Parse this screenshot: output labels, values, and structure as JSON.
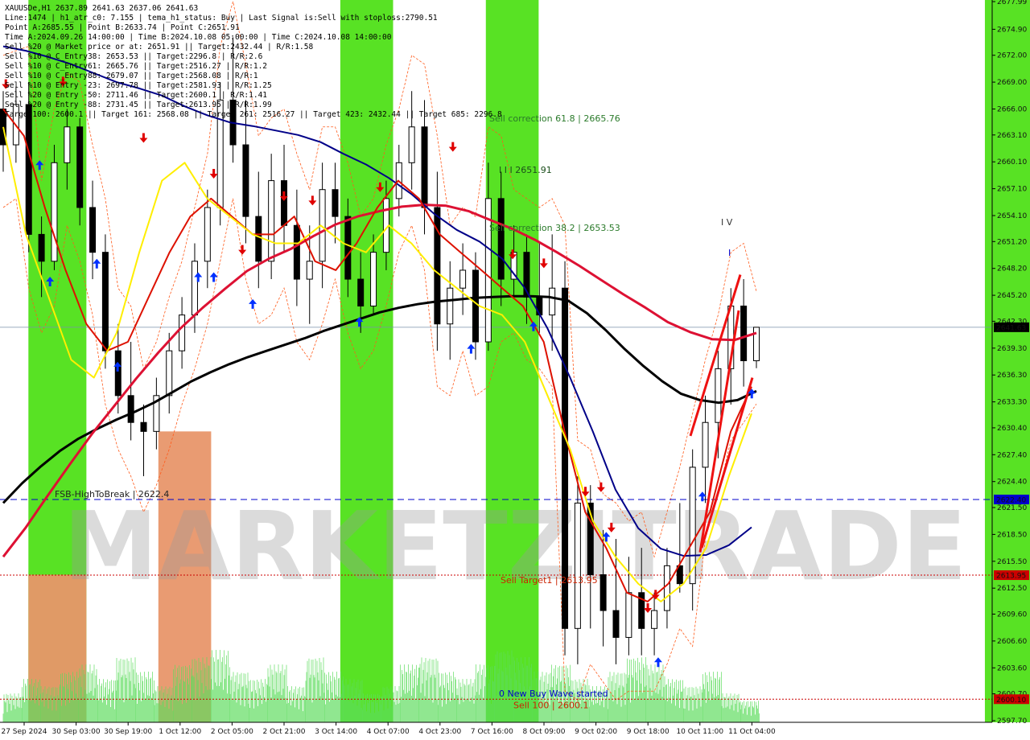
{
  "header_lines": [
    "XAUUSDe,H1  2637.89 2641.63 2637.06 2641.63",
    "Line:1474 | h1_atr_c0: 7.155 | tema_h1_status: Buy | Last Signal is:Sell with stoploss:2790.51",
    "Point A:2685.55 | Point B:2633.74 | Point C:2651.91",
    "Time A:2024.09.26 14:00:00 | Time B:2024.10.08 05:00:00 | Time C:2024.10.08 14:00:00",
    "Sell %20 @ Market price or at: 2651.91 || Target:2432.44 | R/R:1.58",
    "Sell %10 @ C_Entry38: 2653.53 || Target:2296.8 | R/R:2.6",
    "Sell %10 @ C_Entry61: 2665.76 || Target:2516.27 | R/R:1.2",
    "Sell %10 @ C_Entry88: 2679.07 || Target:2568.08 | R/R:1",
    "Sell %10 @ Entry -23: 2697.78 || Target:2581.93 | R/R:1.25",
    "Sell %20 @ Entry -50: 2711.46 || Target:2600.1 | R/R:1.41",
    "Sell %20 @ Entry -88: 2731.45 || Target:2613.95 | R/R:1.99",
    "Target100: 2600.1 || Target 161: 2568.08 || Target 261: 2516.27 || Target 423: 2432.44 || Target 685: 2296.8"
  ],
  "chart_data": {
    "type": "candlestick",
    "symbol": "XAUUSDe",
    "timeframe": "H1",
    "ylim": [
      2597.7,
      2677.99
    ],
    "y_ticks": [
      "2677.99",
      "2674.90",
      "2672.00",
      "2669.00",
      "2666.00",
      "2663.10",
      "2660.10",
      "2657.10",
      "2654.10",
      "2651.20",
      "2648.20",
      "2645.20",
      "2642.30",
      "2639.30",
      "2636.30",
      "2633.30",
      "2630.40",
      "2627.40",
      "2624.40",
      "2621.50",
      "2618.50",
      "2615.50",
      "2612.50",
      "2609.60",
      "2606.60",
      "2603.60",
      "2600.70",
      "2597.70"
    ],
    "x_ticks": [
      "27 Sep 2024",
      "30 Sep 03:00",
      "30 Sep 19:00",
      "1 Oct 12:00",
      "2 Oct 05:00",
      "2 Oct 21:00",
      "3 Oct 14:00",
      "4 Oct 07:00",
      "4 Oct 23:00",
      "7 Oct 16:00",
      "8 Oct 09:00",
      "9 Oct 02:00",
      "9 Oct 18:00",
      "10 Oct 11:00",
      "11 Oct 04:00"
    ],
    "price_tags": [
      {
        "value": 2641.63,
        "label": "2641.63",
        "color": "#000000"
      },
      {
        "value": 2622.4,
        "label": "2622.40",
        "color": "#0000cc"
      },
      {
        "value": 2613.95,
        "label": "2613.95",
        "color": "#cc0000"
      },
      {
        "value": 2600.1,
        "label": "2600.10",
        "color": "#cc0000"
      }
    ],
    "levels": [
      {
        "name": "FSB-HighToBreak",
        "value": 2622.4,
        "label": "FSB-HighToBreak | 2622.4",
        "color": "#0000cc"
      },
      {
        "name": "Sell Target1",
        "value": 2613.95,
        "label": "Sell Target1 | 2613.95",
        "color": "#cc0000"
      },
      {
        "name": "Sell 100",
        "value": 2600.1,
        "label": "Sell 100 | 2600.1",
        "color": "#cc0000"
      }
    ],
    "annotations": [
      {
        "text": "Sell correction 61.8 | 2665.76",
        "color": "#2a7a2a"
      },
      {
        "text": "Sell correction 38.2 | 2653.53",
        "color": "#2a7a2a"
      },
      {
        "text": "I I I  2651.91",
        "color": "#2a7a2a"
      },
      {
        "text": "I V",
        "color": "#333333"
      },
      {
        "text": "I",
        "color": "#0000cc"
      },
      {
        "text": "0 New Buy Wave started",
        "color": "#0000cc"
      }
    ],
    "green_bands": [
      [
        0.5,
        1.6
      ],
      [
        6.5,
        7.5
      ],
      [
        9.3,
        10.3
      ],
      [
        18.9,
        20.0
      ],
      [
        21.3,
        22.2
      ],
      [
        23.8,
        24.7
      ]
    ],
    "orange_bands": [
      [
        0.5,
        1.6,
        2614.0
      ],
      [
        3.0,
        4.0,
        2630.0
      ]
    ],
    "candles": [
      [
        2666.0,
        2668.0,
        2659.0,
        2662.0
      ],
      [
        2662.0,
        2668.5,
        2660.0,
        2666.5
      ],
      [
        2666.5,
        2669.0,
        2650.0,
        2652.0
      ],
      [
        2652.0,
        2654.0,
        2645.0,
        2649.0
      ],
      [
        2649.0,
        2662.0,
        2648.0,
        2660.0
      ],
      [
        2660.0,
        2666.0,
        2657.0,
        2664.0
      ],
      [
        2664.0,
        2665.0,
        2653.0,
        2655.0
      ],
      [
        2655.0,
        2658.0,
        2647.0,
        2650.0
      ],
      [
        2650.0,
        2652.0,
        2637.0,
        2639.0
      ],
      [
        2639.0,
        2642.0,
        2632.0,
        2634.0
      ],
      [
        2634.0,
        2640.0,
        2629.0,
        2631.0
      ],
      [
        2631.0,
        2633.0,
        2625.0,
        2630.0
      ],
      [
        2630.0,
        2636.0,
        2628.0,
        2634.0
      ],
      [
        2634.0,
        2641.0,
        2632.0,
        2639.0
      ],
      [
        2639.0,
        2645.0,
        2637.0,
        2643.0
      ],
      [
        2643.0,
        2651.0,
        2641.0,
        2649.0
      ],
      [
        2649.0,
        2657.0,
        2646.0,
        2655.0
      ],
      [
        2655.0,
        2669.0,
        2653.0,
        2667.0
      ],
      [
        2667.0,
        2674.0,
        2660.0,
        2662.0
      ],
      [
        2662.0,
        2667.0,
        2651.0,
        2654.0
      ],
      [
        2654.0,
        2659.0,
        2646.0,
        2649.0
      ],
      [
        2649.0,
        2661.0,
        2647.0,
        2658.0
      ],
      [
        2658.0,
        2662.0,
        2650.0,
        2653.0
      ],
      [
        2653.0,
        2657.0,
        2644.0,
        2647.0
      ],
      [
        2647.0,
        2653.0,
        2642.0,
        2649.0
      ],
      [
        2649.0,
        2660.0,
        2646.0,
        2657.0
      ],
      [
        2657.0,
        2660.0,
        2651.0,
        2654.0
      ],
      [
        2654.0,
        2656.0,
        2645.0,
        2647.0
      ],
      [
        2647.0,
        2650.0,
        2641.0,
        2644.0
      ],
      [
        2644.0,
        2652.0,
        2643.0,
        2650.0
      ],
      [
        2650.0,
        2658.0,
        2648.0,
        2656.0
      ],
      [
        2656.0,
        2662.0,
        2654.0,
        2660.0
      ],
      [
        2660.0,
        2668.0,
        2657.0,
        2664.0
      ],
      [
        2664.0,
        2667.0,
        2652.0,
        2655.0
      ],
      [
        2655.0,
        2659.0,
        2639.0,
        2642.0
      ],
      [
        2642.0,
        2649.0,
        2638.0,
        2646.0
      ],
      [
        2646.0,
        2651.0,
        2643.0,
        2648.0
      ],
      [
        2648.0,
        2650.0,
        2638.0,
        2640.0
      ],
      [
        2640.0,
        2660.0,
        2639.0,
        2656.0
      ],
      [
        2656.0,
        2659.0,
        2644.0,
        2647.0
      ],
      [
        2647.0,
        2653.0,
        2645.0,
        2650.0
      ],
      [
        2650.0,
        2652.0,
        2642.0,
        2645.0
      ],
      [
        2645.0,
        2651.0,
        2641.0,
        2643.0
      ],
      [
        2643.0,
        2652.0,
        2639.0,
        2646.0
      ],
      [
        2646.0,
        2649.0,
        2605.0,
        2608.0
      ],
      [
        2608.0,
        2625.0,
        2604.0,
        2622.0
      ],
      [
        2622.0,
        2624.0,
        2608.0,
        2614.0
      ],
      [
        2614.0,
        2619.0,
        2606.0,
        2610.0
      ],
      [
        2610.0,
        2618.0,
        2604.0,
        2607.0
      ],
      [
        2607.0,
        2616.0,
        2605.0,
        2612.0
      ],
      [
        2612.0,
        2617.0,
        2605.0,
        2608.0
      ],
      [
        2608.0,
        2612.0,
        2605.0,
        2610.0
      ],
      [
        2610.0,
        2617.0,
        2608.0,
        2615.0
      ],
      [
        2615.0,
        2622.0,
        2612.0,
        2613.0
      ],
      [
        2613.0,
        2628.0,
        2610.0,
        2626.0
      ],
      [
        2626.0,
        2634.0,
        2622.0,
        2631.0
      ],
      [
        2631.0,
        2639.0,
        2627.0,
        2637.0
      ],
      [
        2637.0,
        2646.0,
        2633.0,
        2644.0
      ],
      [
        2644.0,
        2647.0,
        2635.0,
        2637.89
      ],
      [
        2637.89,
        2641.63,
        2637.06,
        2641.63
      ]
    ],
    "series": [
      {
        "name": "ma_slow",
        "color": "#000000",
        "width": 3,
        "values": [
          2622,
          2624.2,
          2626.1,
          2627.8,
          2629.2,
          2630.3,
          2631.3,
          2632.2,
          2633.2,
          2634.4,
          2635.6,
          2636.6,
          2637.5,
          2638.3,
          2639.0,
          2639.7,
          2640.4,
          2641.2,
          2641.9,
          2642.6,
          2643.3,
          2643.8,
          2644.2,
          2644.5,
          2644.7,
          2644.9,
          2645.0,
          2645.1,
          2645.1,
          2645.0,
          2644.6,
          2643.2,
          2641.3,
          2639.2,
          2637.3,
          2635.6,
          2634.2,
          2633.5,
          2633.2,
          2633.5,
          2634.5
        ]
      },
      {
        "name": "ma_mid",
        "color": "#dd1133",
        "width": 3,
        "values": [
          2616,
          2619.2,
          2622.8,
          2626.3,
          2629.7,
          2632.8,
          2635.9,
          2638.8,
          2641.5,
          2643.8,
          2645.9,
          2647.9,
          2649.3,
          2650.4,
          2651.8,
          2653.1,
          2654.0,
          2654.6,
          2655.1,
          2655.3,
          2655.2,
          2654.6,
          2653.6,
          2652.6,
          2651.4,
          2650.0,
          2648.5,
          2646.9,
          2645.3,
          2643.8,
          2642.2,
          2641.1,
          2640.3,
          2640.2,
          2641.0
        ]
      },
      {
        "name": "ma_blue",
        "color": "#000088",
        "width": 2,
        "values": [
          2673.0,
          2672.5,
          2671.8,
          2671.0,
          2670.0,
          2669.0,
          2668.3,
          2667.5,
          2666.3,
          2665.3,
          2664.5,
          2664.1,
          2663.6,
          2663.1,
          2662.3,
          2661.0,
          2659.8,
          2658.3,
          2656.5,
          2654.3,
          2652.5,
          2651.2,
          2649.3,
          2646.0,
          2641.5,
          2636.0,
          2630.0,
          2623.5,
          2619.2,
          2616.9,
          2616.1,
          2616.2,
          2617.3,
          2619.3
        ]
      },
      {
        "name": "ma_red_fast",
        "color": "#dd1100",
        "width": 2,
        "values": [
          2666.0,
          2663.0,
          2655.0,
          2648.0,
          2642.0,
          2639.0,
          2640.0,
          2645.0,
          2650.0,
          2654.0,
          2656.0,
          2654.0,
          2652.0,
          2652.0,
          2654.0,
          2649.0,
          2648.0,
          2651.0,
          2655.0,
          2658.0,
          2656.0,
          2652.0,
          2650.0,
          2648.0,
          2646.0,
          2644.0,
          2640.0,
          2630.0,
          2621.0,
          2617.0,
          2612.0,
          2611.0,
          2613.0,
          2617.0,
          2621.0,
          2630.0,
          2635.0
        ]
      },
      {
        "name": "ma_yellow",
        "color": "#ffee00",
        "width": 2,
        "values": [
          2664.0,
          2652.0,
          2645.0,
          2638.0,
          2636.0,
          2641.0,
          2650.0,
          2658.0,
          2660.0,
          2656.0,
          2654.0,
          2652.0,
          2651.0,
          2651.0,
          2653.0,
          2651.0,
          2650.0,
          2653.0,
          2651.0,
          2648.0,
          2646.0,
          2644.0,
          2643.0,
          2640.0,
          2634.0,
          2628.0,
          2620.0,
          2616.0,
          2613.0,
          2611.0,
          2613.0,
          2617.0,
          2625.0,
          2632.0
        ]
      }
    ],
    "arrows_down": [
      [
        0.1,
        2668.5
      ],
      [
        2.3,
        2668.8
      ],
      [
        5.4,
        2662.5
      ],
      [
        8.1,
        2658.5
      ],
      [
        9.2,
        2650.0
      ],
      [
        10.8,
        2656.0
      ],
      [
        11.9,
        2655.5
      ],
      [
        14.5,
        2657.0
      ],
      [
        17.3,
        2661.5
      ],
      [
        19.6,
        2649.5
      ],
      [
        20.8,
        2648.5
      ],
      [
        22.4,
        2623.0
      ],
      [
        23.0,
        2623.5
      ],
      [
        23.4,
        2619.0
      ],
      [
        24.8,
        2610.0
      ],
      [
        25.1,
        2611.5
      ]
    ],
    "arrows_up": [
      [
        1.4,
        2660.0
      ],
      [
        1.8,
        2647.0
      ],
      [
        3.6,
        2649.0
      ],
      [
        4.4,
        2637.5
      ],
      [
        7.5,
        2647.5
      ],
      [
        8.1,
        2647.5
      ],
      [
        9.6,
        2644.5
      ],
      [
        13.7,
        2642.5
      ],
      [
        18.0,
        2639.5
      ],
      [
        20.4,
        2642.0
      ],
      [
        23.2,
        2618.5
      ],
      [
        25.2,
        2604.5
      ],
      [
        26.9,
        2623.0
      ],
      [
        28.8,
        2634.5
      ]
    ],
    "volume_heights": [
      0.4,
      0.6,
      0.5,
      0.7,
      0.8,
      0.6,
      0.9,
      0.7,
      0.5,
      0.8,
      0.9,
      1.0,
      0.7,
      0.6,
      0.8,
      0.5,
      0.9,
      0.7,
      0.6,
      0.4,
      0.5,
      0.8,
      0.9,
      0.7,
      0.6,
      0.8,
      1.0,
      0.9,
      0.7,
      0.8,
      0.6,
      0.5,
      0.7,
      0.9,
      0.8,
      0.6,
      0.5,
      0.7,
      0.4,
      0.3
    ]
  }
}
